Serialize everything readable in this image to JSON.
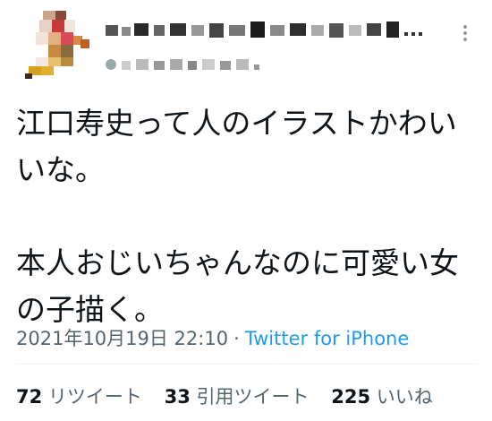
{
  "tweet": {
    "text_lines": [
      "江口寿史って人のイラストかわい",
      "いな。",
      "",
      "本人おじいちゃんなのに可愛い女",
      "の子描く。"
    ],
    "timestamp": "2021年10月19日 22:10",
    "separator": "·",
    "source": "Twitter for iPhone",
    "more_icon": "ellipsis-vertical-icon"
  },
  "stats": {
    "retweets": {
      "count": "72",
      "label": "リツイート"
    },
    "quotes": {
      "count": "33",
      "label": "引用ツイート"
    },
    "likes": {
      "count": "225",
      "label": "いいね"
    }
  },
  "colors": {
    "text": "#0f1419",
    "muted": "#536471",
    "link": "#1d9bf0",
    "divider": "#eff3f4"
  }
}
